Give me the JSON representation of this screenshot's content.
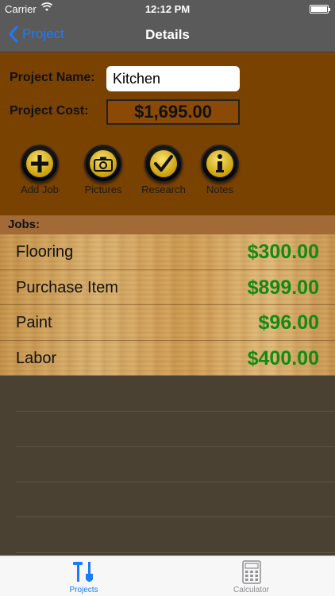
{
  "status_bar": {
    "carrier": "Carrier",
    "time": "12:12 PM"
  },
  "nav": {
    "back_label": "Project",
    "title": "Details"
  },
  "project": {
    "name_label": "Project Name:",
    "name_value": "Kitchen",
    "cost_label": "Project Cost:",
    "cost_value": "$1,695.00"
  },
  "actions": [
    {
      "label": "Add Job",
      "icon": "plus-icon"
    },
    {
      "label": "Pictures",
      "icon": "camera-icon"
    },
    {
      "label": "Research",
      "icon": "checkmark-icon"
    },
    {
      "label": "Notes",
      "icon": "info-icon"
    }
  ],
  "jobs": {
    "header": "Jobs:",
    "items": [
      {
        "name": "Flooring",
        "amount": "$300.00"
      },
      {
        "name": "Purchase Item",
        "amount": "$899.00"
      },
      {
        "name": "Paint",
        "amount": "$96.00"
      },
      {
        "name": "Labor",
        "amount": "$400.00"
      }
    ]
  },
  "tabs": [
    {
      "label": "Projects",
      "icon": "tools-icon",
      "active": true
    },
    {
      "label": "Calculator",
      "icon": "calculator-icon",
      "active": false
    }
  ],
  "colors": {
    "accent": "#1a7bff",
    "amount_green": "#138a13",
    "header_brown": "#7a4200",
    "nav_gray": "#5a5a5a"
  }
}
